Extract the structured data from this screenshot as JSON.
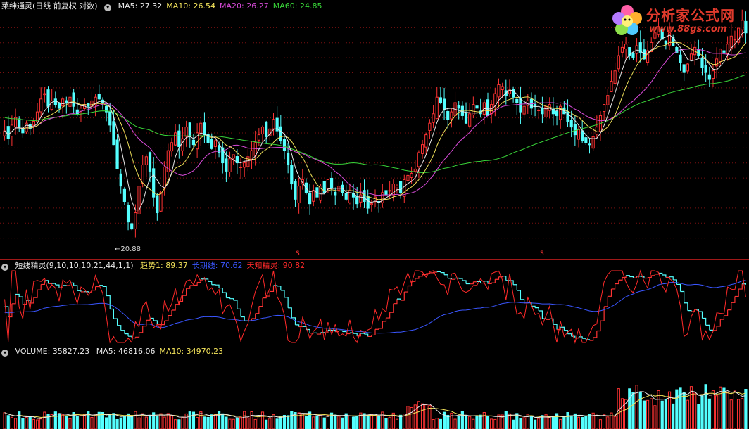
{
  "main": {
    "title": "莱绅通灵(日线 前复权 对数)",
    "indicators": [
      {
        "label": "MA5: 27.32",
        "color": "#e8e8e8"
      },
      {
        "label": "MA10: 26.54",
        "color": "#f2e25a"
      },
      {
        "label": "MA20: 26.27",
        "color": "#d94bd9"
      },
      {
        "label": "MA60: 24.85",
        "color": "#39d639"
      }
    ],
    "low_marker": "←20.88",
    "s_marker": "S"
  },
  "osc": {
    "title": "短线精灵(9,10,10,10,21,44,1,1)",
    "indicators": [
      {
        "label": "趋势1: 89.37",
        "color": "#f2e25a"
      },
      {
        "label": "长期线: 70.62",
        "color": "#3a56ff"
      },
      {
        "label": "天知精灵: 90.82",
        "color": "#ff2a2a"
      }
    ]
  },
  "vol": {
    "title": "VOLUME: 35827.23",
    "indicators": [
      {
        "label": "MA5: 46816.06",
        "color": "#e8e8e8"
      },
      {
        "label": "MA10: 34970.23",
        "color": "#f2e25a"
      }
    ]
  },
  "logo": {
    "text": "分析家公式网",
    "url_text": "www.88gs.com"
  },
  "colors": {
    "up": "#ff3333",
    "down": "#54ffff",
    "ma5": "#e8e8e8",
    "ma10": "#f2e25a",
    "ma20": "#d94bd9",
    "ma60": "#39d639",
    "grid": "#7a1010"
  },
  "chart_data": [
    {
      "type": "candlestick",
      "title": "莱绅通灵(日线 前复权 对数)",
      "scale": "log",
      "ylim": [
        20.0,
        32.5
      ],
      "annotations": [
        {
          "text": "←20.88",
          "value": 20.88
        }
      ],
      "series": [
        {
          "name": "MA5",
          "value": 27.32
        },
        {
          "name": "MA10",
          "value": 26.54
        },
        {
          "name": "MA20",
          "value": 26.27
        },
        {
          "name": "MA60",
          "value": 24.85
        }
      ],
      "close": [
        25.6,
        25.2,
        25.9,
        26.3,
        25.8,
        25.5,
        26.0,
        25.7,
        26.1,
        26.6,
        27.3,
        27.6,
        26.9,
        27.2,
        27.0,
        26.8,
        27.3,
        27.1,
        27.4,
        26.9,
        26.5,
        26.8,
        27.0,
        26.9,
        27.2,
        27.4,
        27.3,
        27.1,
        26.6,
        25.9,
        24.9,
        23.7,
        22.9,
        22.2,
        21.3,
        21.0,
        21.7,
        22.9,
        23.9,
        24.3,
        23.6,
        22.4,
        21.7,
        22.6,
        23.8,
        24.6,
        25.0,
        25.5,
        24.8,
        25.2,
        25.8,
        25.3,
        24.9,
        25.5,
        26.0,
        25.4,
        25.0,
        24.7,
        25.1,
        24.5,
        24.0,
        23.6,
        24.2,
        24.4,
        24.0,
        23.8,
        24.0,
        24.3,
        24.6,
        25.0,
        25.4,
        25.8,
        25.3,
        25.7,
        26.2,
        25.6,
        25.1,
        24.6,
        23.9,
        23.0,
        22.3,
        22.9,
        23.2,
        22.6,
        22.1,
        22.7,
        22.4,
        22.9,
        22.6,
        23.2,
        22.8,
        22.5,
        22.9,
        22.6,
        22.3,
        22.7,
        22.4,
        22.1,
        22.5,
        22.2,
        21.9,
        22.1,
        22.4,
        22.2,
        22.6,
        22.5,
        22.7,
        23.0,
        22.9,
        22.6,
        23.2,
        23.4,
        23.5,
        23.7,
        24.5,
        24.9,
        25.4,
        26.0,
        26.5,
        27.4,
        27.1,
        26.7,
        26.2,
        26.6,
        27.1,
        26.8,
        26.4,
        26.0,
        26.5,
        27.0,
        26.8,
        26.5,
        27.1,
        26.4,
        27.0,
        27.6,
        28.1,
        28.0,
        27.5,
        27.8,
        27.4,
        27.1,
        26.6,
        26.9,
        27.2,
        26.8,
        26.9,
        26.7,
        26.5,
        26.9,
        27.0,
        26.5,
        26.4,
        26.9,
        26.5,
        26.1,
        25.8,
        25.4,
        25.7,
        25.1,
        25.0,
        24.9,
        25.3,
        25.8,
        26.4,
        27.0,
        27.5,
        28.3,
        28.9,
        29.8,
        30.3,
        30.5,
        29.8,
        29.7,
        30.4,
        30.0,
        29.6,
        30.1,
        30.6,
        31.2,
        31.6,
        30.8,
        30.5,
        31.2,
        30.4,
        30.0,
        29.4,
        28.8,
        29.3,
        29.9,
        30.3,
        29.8,
        29.1,
        28.8,
        28.4,
        28.9,
        29.6,
        30.2,
        30.0,
        30.5,
        31.0,
        30.8,
        31.5,
        32.0,
        31.2
      ]
    },
    {
      "type": "line",
      "title": "短线精灵(9,10,10,10,21,44,1,1)",
      "ylim": [
        0,
        100
      ],
      "series": [
        {
          "name": "趋势1",
          "value": 89.37
        },
        {
          "name": "长期线",
          "value": 70.62
        },
        {
          "name": "天知精灵",
          "value": 90.82
        }
      ]
    },
    {
      "type": "bar",
      "title": "VOLUME",
      "series": [
        {
          "name": "VOLUME",
          "value": 35827.23
        },
        {
          "name": "MA5",
          "value": 46816.06
        },
        {
          "name": "MA10",
          "value": 34970.23
        }
      ]
    }
  ]
}
